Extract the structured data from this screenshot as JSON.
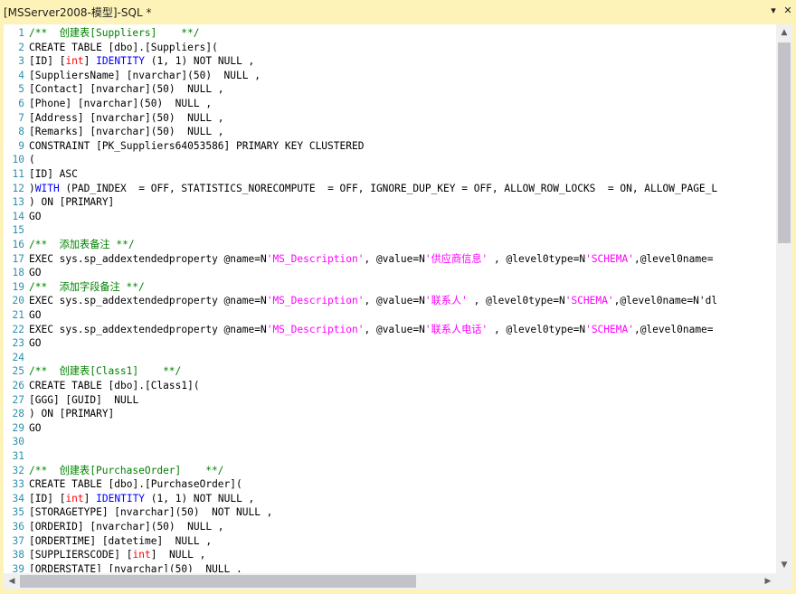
{
  "window": {
    "title": "[MSServer2008-模型]-SQL *",
    "dropdown_glyph": "▾",
    "close_glyph": "✕"
  },
  "colors": {
    "background": "#fdf3b8",
    "line_number": "#2b91af",
    "comment": "#008000",
    "keyword": "#0000ff",
    "type": "#ff0000",
    "string": "#ff00ff"
  },
  "editor": {
    "lines": [
      {
        "n": "1",
        "t": "/**  创建表[Suppliers]    **/"
      },
      {
        "n": "2",
        "t": "CREATE TABLE [dbo].[Suppliers]("
      },
      {
        "n": "3",
        "t": "[ID] [int] IDENTITY (1, 1) NOT NULL ,"
      },
      {
        "n": "4",
        "t": "[SuppliersName] [nvarchar](50)  NULL ,"
      },
      {
        "n": "5",
        "t": "[Contact] [nvarchar](50)  NULL ,"
      },
      {
        "n": "6",
        "t": "[Phone] [nvarchar](50)  NULL ,"
      },
      {
        "n": "7",
        "t": "[Address] [nvarchar](50)  NULL ,"
      },
      {
        "n": "8",
        "t": "[Remarks] [nvarchar](50)  NULL ,"
      },
      {
        "n": "9",
        "t": "CONSTRAINT [PK_Suppliers64053586] PRIMARY KEY CLUSTERED"
      },
      {
        "n": "10",
        "t": "("
      },
      {
        "n": "11",
        "t": "[ID] ASC"
      },
      {
        "n": "12",
        "t": ")WITH (PAD_INDEX  = OFF, STATISTICS_NORECOMPUTE  = OFF, IGNORE_DUP_KEY = OFF, ALLOW_ROW_LOCKS  = ON, ALLOW_PAGE_L"
      },
      {
        "n": "13",
        "t": ") ON [PRIMARY]"
      },
      {
        "n": "14",
        "t": "GO"
      },
      {
        "n": "15",
        "t": ""
      },
      {
        "n": "16",
        "t": "/**  添加表备注 **/"
      },
      {
        "n": "17",
        "t": "EXEC sys.sp_addextendedproperty @name=N'MS_Description', @value=N'供应商信息' , @level0type=N'SCHEMA',@level0name="
      },
      {
        "n": "18",
        "t": "GO"
      },
      {
        "n": "19",
        "t": "/**  添加字段备注 **/"
      },
      {
        "n": "20",
        "t": "EXEC sys.sp_addextendedproperty @name=N'MS_Description', @value=N'联系人' , @level0type=N'SCHEMA',@level0name=N'dl"
      },
      {
        "n": "21",
        "t": "GO"
      },
      {
        "n": "22",
        "t": "EXEC sys.sp_addextendedproperty @name=N'MS_Description', @value=N'联系人电话' , @level0type=N'SCHEMA',@level0name="
      },
      {
        "n": "23",
        "t": "GO"
      },
      {
        "n": "24",
        "t": ""
      },
      {
        "n": "25",
        "t": "/**  创建表[Class1]    **/"
      },
      {
        "n": "26",
        "t": "CREATE TABLE [dbo].[Class1]("
      },
      {
        "n": "27",
        "t": "[GGG] [GUID]  NULL"
      },
      {
        "n": "28",
        "t": ") ON [PRIMARY]"
      },
      {
        "n": "29",
        "t": "GO"
      },
      {
        "n": "30",
        "t": ""
      },
      {
        "n": "31",
        "t": ""
      },
      {
        "n": "32",
        "t": "/**  创建表[PurchaseOrder]    **/"
      },
      {
        "n": "33",
        "t": "CREATE TABLE [dbo].[PurchaseOrder]("
      },
      {
        "n": "34",
        "t": "[ID] [int] IDENTITY (1, 1) NOT NULL ,"
      },
      {
        "n": "35",
        "t": "[STORAGETYPE] [nvarchar](50)  NOT NULL ,"
      },
      {
        "n": "36",
        "t": "[ORDERID] [nvarchar](50)  NULL ,"
      },
      {
        "n": "37",
        "t": "[ORDERTIME] [datetime]  NULL ,"
      },
      {
        "n": "38",
        "t": "[SUPPLIERSCODE] [int]  NULL ,"
      },
      {
        "n": "39",
        "t": "[ORDERSTATE] [nvarchar](50)  NULL ,"
      }
    ]
  },
  "scrollbars": {
    "up_arrow": "▲",
    "down_arrow": "▼",
    "left_arrow": "◀",
    "right_arrow": "▶"
  }
}
